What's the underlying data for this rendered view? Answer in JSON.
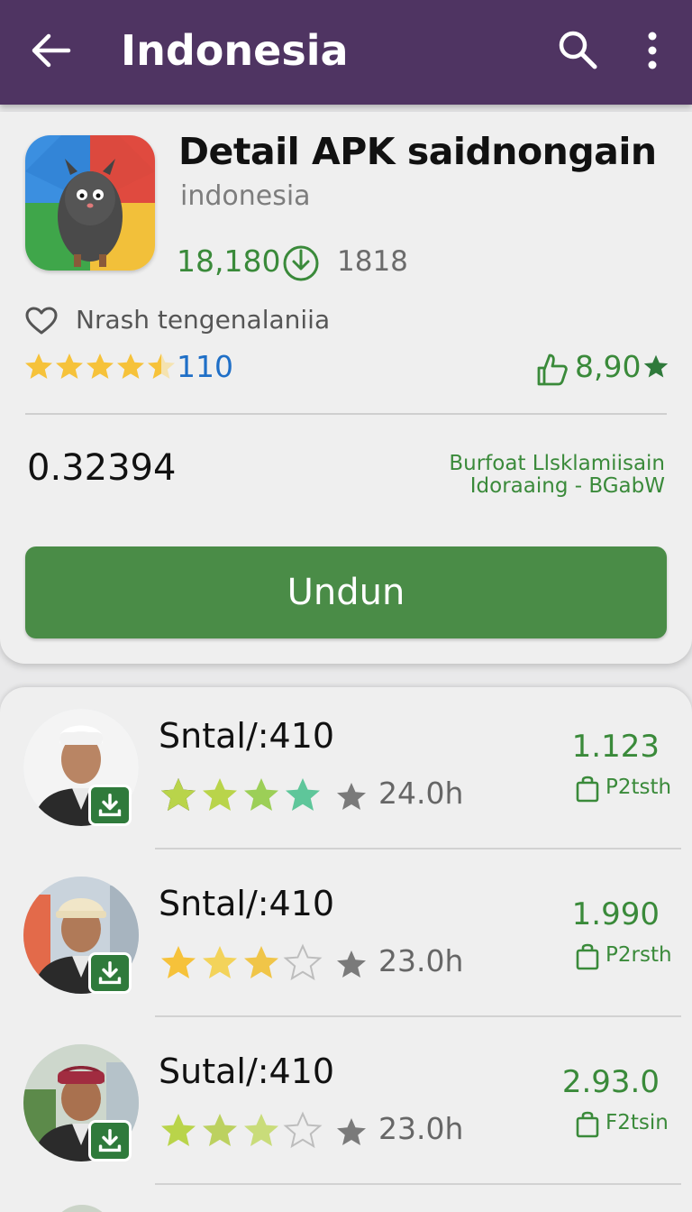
{
  "appbar": {
    "title": "Indonesia",
    "back_icon": "arrow-left-icon",
    "search_icon": "search-icon",
    "more_icon": "more-vert-icon",
    "color": "#4f3462"
  },
  "app": {
    "title": "Detail APK saidnongain",
    "subtitle": "indonesia",
    "downloads": "18,180",
    "downloads_secondary": "1818",
    "wishlist_text": "Nrash tengenalaniia",
    "rating_stars": 4.5,
    "rating_count": "110",
    "likes": "8,90",
    "price": "0.32394",
    "meta_line1": "Burfoat Llsklamiisain",
    "meta_line2": "Idoraaing - BGabW",
    "install_label": "Undun",
    "accent": "#4a8c47"
  },
  "list": [
    {
      "title": "Sntal/:410",
      "stars": 4,
      "time": "24.0h",
      "value": "1.123",
      "tag": "P2tsth"
    },
    {
      "title": "Sntal/:410",
      "stars": 3,
      "time": "23.0h",
      "value": "1.990",
      "tag": "P2rsth"
    },
    {
      "title": "Sutal/:410",
      "stars": 3,
      "time": "23.0h",
      "value": "2.93.0",
      "tag": "F2tsin"
    }
  ]
}
